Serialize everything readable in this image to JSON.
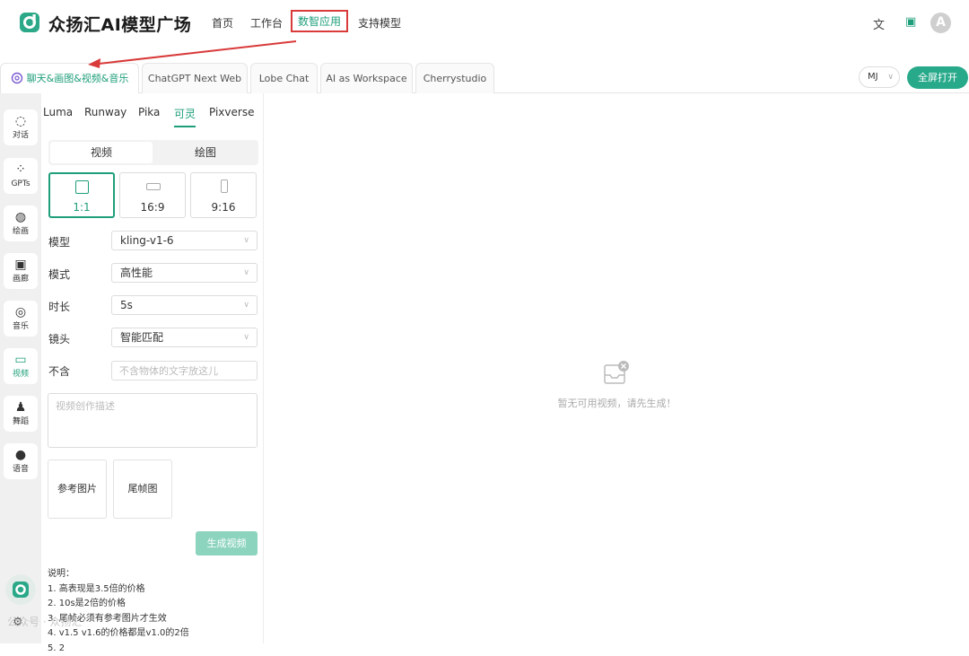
{
  "header": {
    "brand": "众扬汇AI模型广场",
    "nav": [
      "首页",
      "工作台",
      "数智应用",
      "支持模型"
    ],
    "active_nav": "数智应用",
    "avatar_letter": "A"
  },
  "tabs": [
    "聊天&画图&视频&音乐",
    "ChatGPT Next Web",
    "Lobe Chat",
    "AI as Workspace",
    "Cherrystudio"
  ],
  "toolbar": {
    "model_select": "MJ",
    "fullscreen_label": "全屏打开"
  },
  "sidebar": {
    "items": [
      {
        "label": "对话",
        "icon": "chat-icon"
      },
      {
        "label": "GPTs",
        "icon": "grid-icon"
      },
      {
        "label": "绘画",
        "icon": "palette-icon"
      },
      {
        "label": "画廊",
        "icon": "image-icon"
      },
      {
        "label": "音乐",
        "icon": "music-icon"
      },
      {
        "label": "视频",
        "icon": "video-icon"
      },
      {
        "label": "舞蹈",
        "icon": "dance-icon"
      },
      {
        "label": "语音",
        "icon": "mic-icon"
      }
    ],
    "active": "视频"
  },
  "panel": {
    "providers": [
      "Luma",
      "Runway",
      "Pika",
      "可灵",
      "Pixverse"
    ],
    "active_provider": "可灵",
    "modes": [
      "视频",
      "绘图"
    ],
    "active_mode": "视频",
    "ratios": [
      "1:1",
      "16:9",
      "9:16"
    ],
    "active_ratio": "1:1",
    "fields": {
      "model": {
        "label": "模型",
        "value": "kling-v1-6"
      },
      "mode": {
        "label": "模式",
        "value": "高性能"
      },
      "duration": {
        "label": "时长",
        "value": "5s"
      },
      "camera": {
        "label": "镜头",
        "value": "智能匹配"
      },
      "exclude": {
        "label": "不含",
        "placeholder": "不含物体的文字放这儿"
      }
    },
    "prompt_placeholder": "视频创作描述",
    "uploads": [
      "参考图片",
      "尾帧图"
    ],
    "generate_label": "生成视频",
    "notes": [
      "说明：",
      "1. 高表现是3.5倍的价格",
      "2. 10s是2倍的价格",
      "3. 尾帧必须有参考图片才生效",
      "4. v1.5 v1.6的价格都是v1.0的2倍",
      "5. 2"
    ]
  },
  "main": {
    "empty_text": "暂无可用视频，请先生成！"
  },
  "watermark": "公众号 · 众扬汇",
  "colors": {
    "accent": "#1e9e7a",
    "highlight_box": "#d93a3a",
    "button": "#27a98a"
  }
}
